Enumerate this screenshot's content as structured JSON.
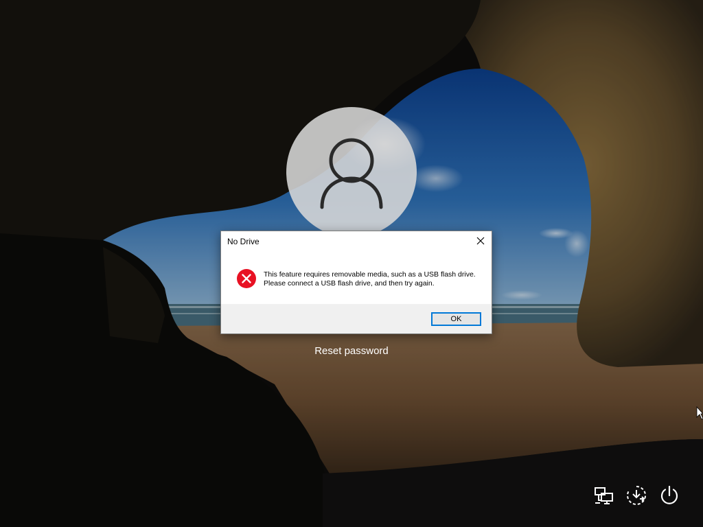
{
  "dialog": {
    "title": "No Drive",
    "message": "This feature requires removable media, such as a USB flash drive. Please connect a USB flash drive, and then try again.",
    "ok_label": "OK",
    "icon": "error-icon",
    "close_icon": "close-icon"
  },
  "login": {
    "avatar_icon": "user-icon",
    "reset_password_label": "Reset password"
  },
  "system_tray": {
    "icons": [
      "network-icon",
      "ease-of-access-icon",
      "power-icon"
    ]
  },
  "colors": {
    "error_red": "#e81123",
    "focus_blue": "#0078d7",
    "dialog_footer": "#f0f0f0"
  }
}
